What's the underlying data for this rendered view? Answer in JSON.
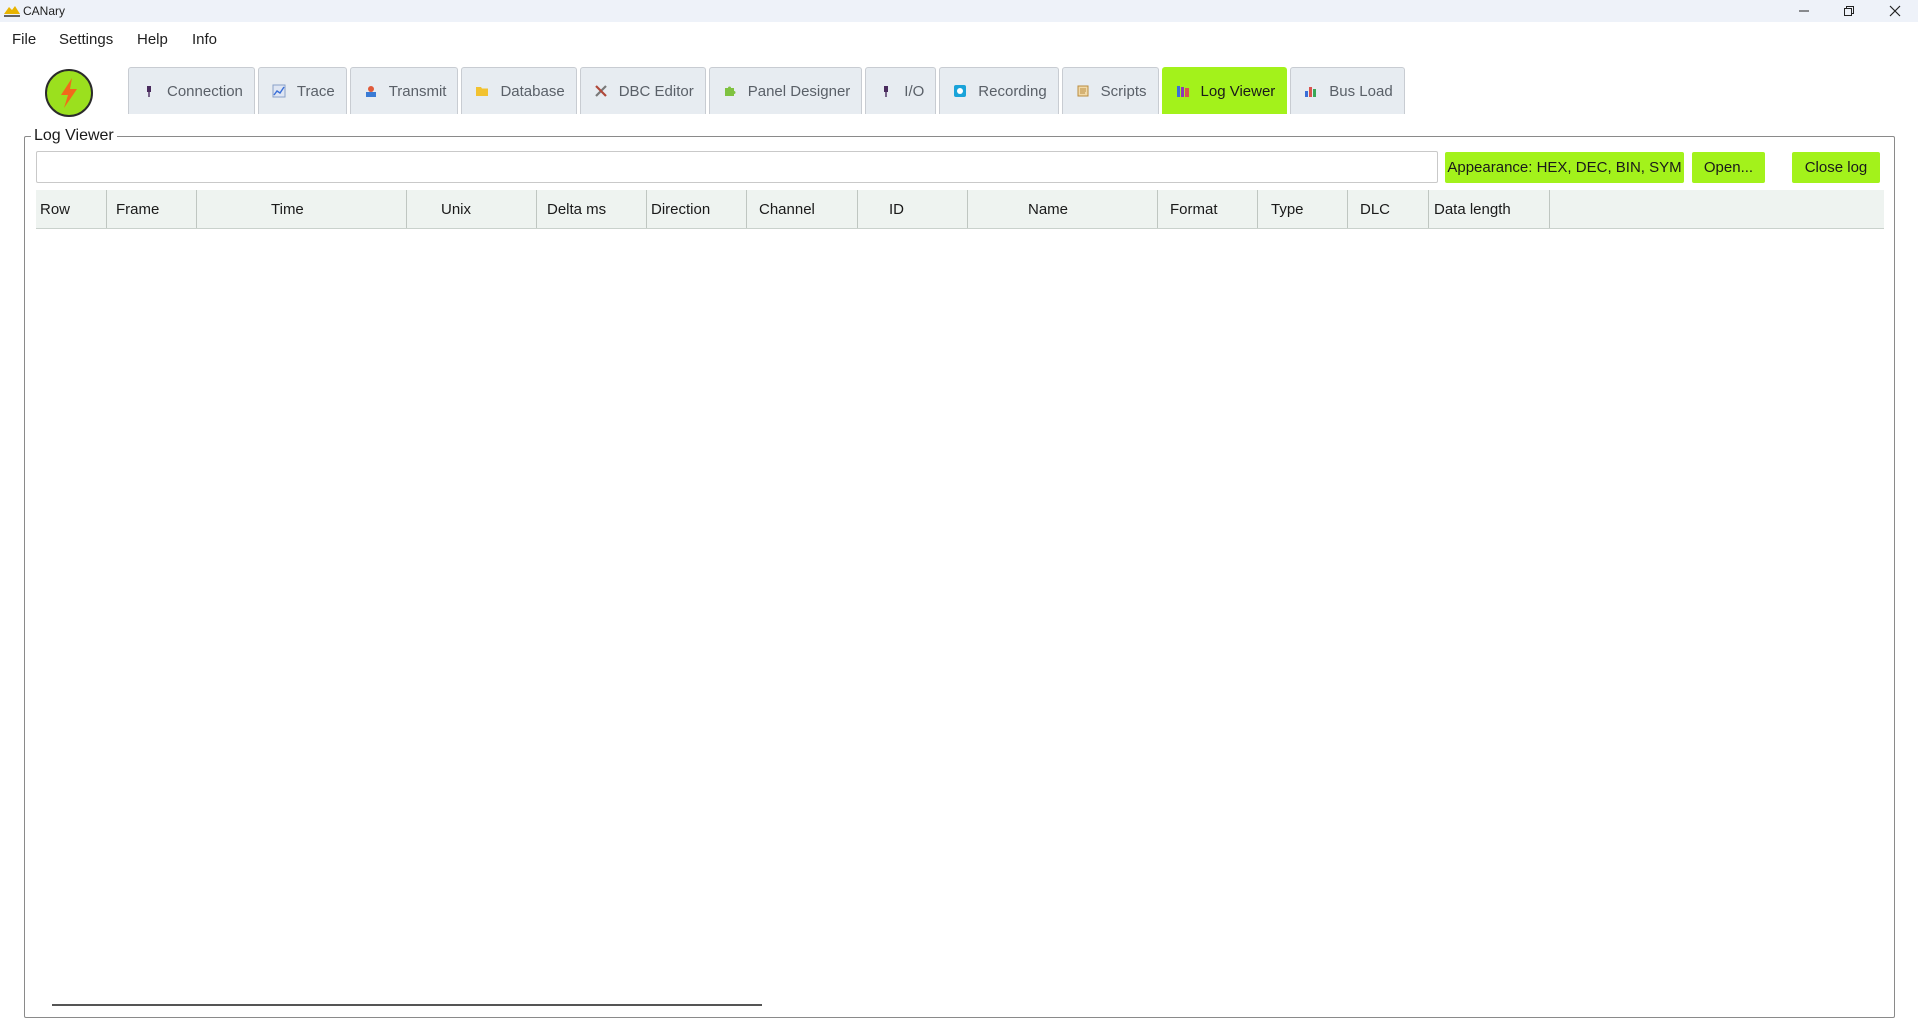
{
  "window": {
    "title": "CANary",
    "minimize_icon": "minimize-icon",
    "maximize_icon": "restore-icon",
    "close_icon": "close-icon"
  },
  "menu": {
    "items": [
      "File",
      "Settings",
      "Help",
      "Info"
    ]
  },
  "logo": {
    "icon": "lightning-bolt-icon",
    "color": "#9be01e"
  },
  "tabs": [
    {
      "label": "Connection",
      "icon": "plug-icon",
      "active": false
    },
    {
      "label": "Trace",
      "icon": "chart-line-icon",
      "active": false
    },
    {
      "label": "Transmit",
      "icon": "transmit-icon",
      "active": false
    },
    {
      "label": "Database",
      "icon": "folder-icon",
      "active": false
    },
    {
      "label": "DBC Editor",
      "icon": "tools-icon",
      "active": false
    },
    {
      "label": "Panel Designer",
      "icon": "puzzle-icon",
      "active": false
    },
    {
      "label": "I/O",
      "icon": "plug-icon",
      "active": false
    },
    {
      "label": "Recording",
      "icon": "record-icon",
      "active": false
    },
    {
      "label": "Scripts",
      "icon": "scroll-icon",
      "active": false
    },
    {
      "label": "Log Viewer",
      "icon": "books-icon",
      "active": true
    },
    {
      "label": "Bus Load",
      "icon": "bar-chart-icon",
      "active": false
    }
  ],
  "accent_color": "#a3f21b",
  "log_viewer": {
    "group_title": "Log Viewer",
    "filter_value": "",
    "appearance_button": "Appearance: HEX, DEC, BIN, SYM",
    "open_button": "Open...",
    "close_button": "Close log",
    "columns": [
      "Row",
      "Frame",
      "Time",
      "Unix",
      "Delta ms",
      "Direction",
      "Channel",
      "ID",
      "Name",
      "Format",
      "Type",
      "DLC",
      "Data length"
    ],
    "rows": []
  }
}
